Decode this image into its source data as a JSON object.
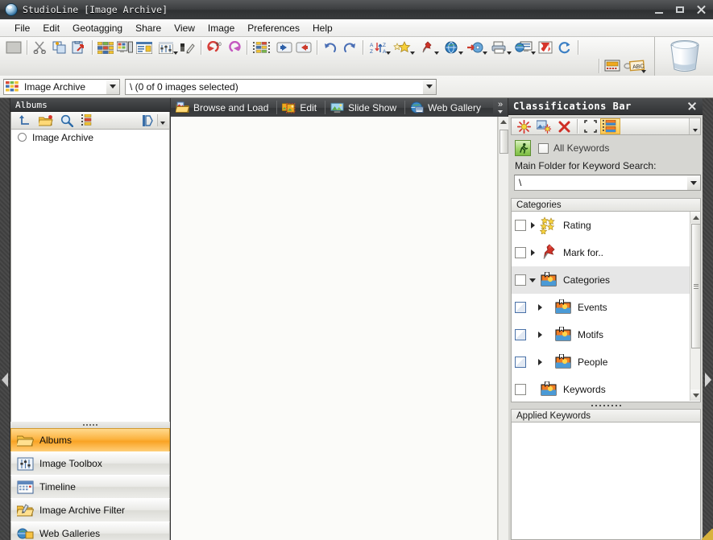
{
  "window": {
    "title": "StudioLine [Image Archive]",
    "app_icon": "studioline-globe-icon",
    "minimize": "minimize-button",
    "maximize": "maximize-button",
    "close": "close-button"
  },
  "menubar": {
    "items": [
      {
        "label": "File"
      },
      {
        "label": "Edit"
      },
      {
        "label": "Geotagging"
      },
      {
        "label": "Share"
      },
      {
        "label": "View"
      },
      {
        "label": "Image"
      },
      {
        "label": "Preferences"
      },
      {
        "label": "Help"
      }
    ]
  },
  "toolbar": {
    "groups": [
      {
        "buttons": [
          {
            "name": "blank-page-button",
            "icon": "blank-rect-icon"
          }
        ]
      },
      {
        "buttons": [
          {
            "name": "cut-button",
            "icon": "scissors-icon"
          },
          {
            "name": "copy-button",
            "icon": "copy-plus-icon"
          },
          {
            "name": "paste-button",
            "icon": "paste-arrow-icon"
          }
        ]
      },
      {
        "buttons": [
          {
            "name": "thumbnail-view-button",
            "icon": "thumbnail-grid-icon"
          },
          {
            "name": "detail-view-button",
            "icon": "monitor-panel-icon"
          },
          {
            "name": "descriptions-view-button",
            "icon": "description-list-icon"
          },
          {
            "name": "image-settings-button",
            "icon": "sliders-icon",
            "has_dropdown": true
          },
          {
            "name": "color-picker-button",
            "icon": "dropper-icon"
          }
        ]
      },
      {
        "buttons": [
          {
            "name": "rotate-right-button",
            "icon": "rotate-cw-90-icon"
          },
          {
            "name": "rotate-left-button",
            "icon": "rotate-ccw-icon"
          }
        ]
      },
      {
        "buttons": [
          {
            "name": "filmstrip-button",
            "icon": "dotted-grid-icon"
          },
          {
            "name": "previous-image-button",
            "icon": "arrow-left-blue-icon"
          },
          {
            "name": "next-image-button",
            "icon": "arrow-right-red-icon"
          }
        ]
      },
      {
        "buttons": [
          {
            "name": "undo-button",
            "icon": "undo-arrow-icon"
          },
          {
            "name": "redo-button",
            "icon": "redo-arrow-icon"
          }
        ]
      },
      {
        "buttons": [
          {
            "name": "sort-button",
            "icon": "sort-az-icon",
            "has_dropdown": true
          },
          {
            "name": "rating-button",
            "icon": "stars-icon",
            "has_dropdown": true
          },
          {
            "name": "mark-for-button",
            "icon": "pushpin-icon",
            "has_dropdown": true
          },
          {
            "name": "web-button",
            "icon": "globe-icon",
            "has_dropdown": true
          },
          {
            "name": "burn-cd-button",
            "icon": "cd-arrow-icon",
            "has_dropdown": true
          },
          {
            "name": "print-button",
            "icon": "printer-icon",
            "has_dropdown": true
          },
          {
            "name": "web-gallery-button",
            "icon": "monitor-globe-icon",
            "has_dropdown": true
          },
          {
            "name": "export-button",
            "icon": "red-flag-icon"
          },
          {
            "name": "refresh-button",
            "icon": "refresh-cycle-icon"
          }
        ]
      }
    ],
    "row2": [
      {
        "name": "presentation-button",
        "icon": "slide-panel-icon"
      },
      {
        "name": "text-label-button",
        "icon": "abc-tag-icon",
        "has_dropdown": true
      }
    ],
    "trash": {
      "name": "trash-bin",
      "icon": "trash-can-icon"
    }
  },
  "addressbar": {
    "archive_selector": {
      "icon": "thumbnail-grid-icon",
      "value": "Image Archive"
    },
    "path_selector": {
      "value": "\\ (0 of 0 images selected)"
    }
  },
  "left_panel": {
    "header": "Albums",
    "toolbar": [
      {
        "name": "go-up-button",
        "icon": "up-level-arrow-icon"
      },
      {
        "name": "new-album-button",
        "icon": "folder-new-icon"
      },
      {
        "name": "find-button",
        "icon": "magnifier-icon"
      },
      {
        "name": "filmstrip-album-button",
        "icon": "film-strip-icon"
      },
      {
        "name": "open-panel-button",
        "icon": "panel-open-icon"
      },
      {
        "name": "toolbar-overflow-button",
        "icon": "chevron-down-icon"
      }
    ],
    "tree": [
      {
        "label": "Image Archive",
        "selected": false
      }
    ],
    "buttons": [
      {
        "label": "Albums",
        "icon": "folder-open-icon",
        "active": true
      },
      {
        "label": "Image Toolbox",
        "icon": "sliders-box-icon",
        "active": false
      },
      {
        "label": "Timeline",
        "icon": "calendar-icon",
        "active": false
      },
      {
        "label": "Image Archive Filter",
        "icon": "folder-filter-icon",
        "active": false
      },
      {
        "label": "Web Galleries",
        "icon": "globe-folder-icon",
        "active": false
      }
    ]
  },
  "center": {
    "tabs": [
      {
        "label": "Browse and Load",
        "icon": "browse-load-icon"
      },
      {
        "label": "Edit",
        "icon": "edit-image-icon"
      },
      {
        "label": "Slide Show",
        "icon": "slideshow-icon"
      },
      {
        "label": "Web Gallery",
        "icon": "web-gallery-icon"
      }
    ],
    "overflow": "chevron-double-right-icon",
    "scrollbar": {
      "up": "scroll-up-arrow",
      "down": "scroll-down-arrow"
    }
  },
  "right_panel": {
    "header": "Classifications Bar",
    "close": "close-icon",
    "toolbar": [
      {
        "name": "new-classification-button",
        "icon": "red-sun-icon"
      },
      {
        "name": "new-category-button",
        "icon": "image-sun-icon"
      },
      {
        "name": "delete-button",
        "icon": "red-x-icon"
      },
      {
        "name": "select-all-button",
        "icon": "selection-frame-icon"
      },
      {
        "name": "show-thumbnails-button",
        "icon": "dotted-image-icon",
        "selected": true
      },
      {
        "name": "toolbar-overflow-button",
        "icon": "chevron-down-icon"
      }
    ],
    "quick_search": {
      "run_button": "runner-green-icon",
      "all_keywords_label": "All Keywords",
      "all_keywords_checked": false
    },
    "main_folder_label": "Main Folder for Keyword Search:",
    "main_folder_value": "\\",
    "categories_header": "Categories",
    "categories": [
      {
        "label": "Rating",
        "icon": "stars-icon",
        "indent": 0,
        "expandable": true,
        "expanded": false,
        "checkbox": "plain",
        "shaded": false
      },
      {
        "label": "Mark for..",
        "icon": "pushpin-icon",
        "indent": 0,
        "expandable": true,
        "expanded": false,
        "checkbox": "plain",
        "shaded": false
      },
      {
        "label": "Categories",
        "icon": "category-icon",
        "indent": 0,
        "expandable": true,
        "expanded": true,
        "checkbox": "plain",
        "shaded": true
      },
      {
        "label": "Events",
        "icon": "category-icon",
        "indent": 1,
        "expandable": true,
        "expanded": false,
        "checkbox": "blue",
        "shaded": false
      },
      {
        "label": "Motifs",
        "icon": "category-icon",
        "indent": 1,
        "expandable": true,
        "expanded": false,
        "checkbox": "blue",
        "shaded": false
      },
      {
        "label": "People",
        "icon": "category-icon",
        "indent": 1,
        "expandable": true,
        "expanded": false,
        "checkbox": "blue",
        "shaded": false
      },
      {
        "label": "Keywords",
        "icon": "category-icon",
        "indent": 0,
        "expandable": false,
        "expanded": false,
        "checkbox": "plain",
        "shaded": false
      }
    ],
    "applied_keywords_header": "Applied Keywords",
    "applied_keywords": []
  },
  "colors": {
    "titlebar_dark": "#3b3d3f",
    "accent_orange": "#f9a324",
    "panel_bg": "#d8d8d4",
    "content_bg": "#fbfbf9",
    "selection_yellow": "#ffc851"
  }
}
